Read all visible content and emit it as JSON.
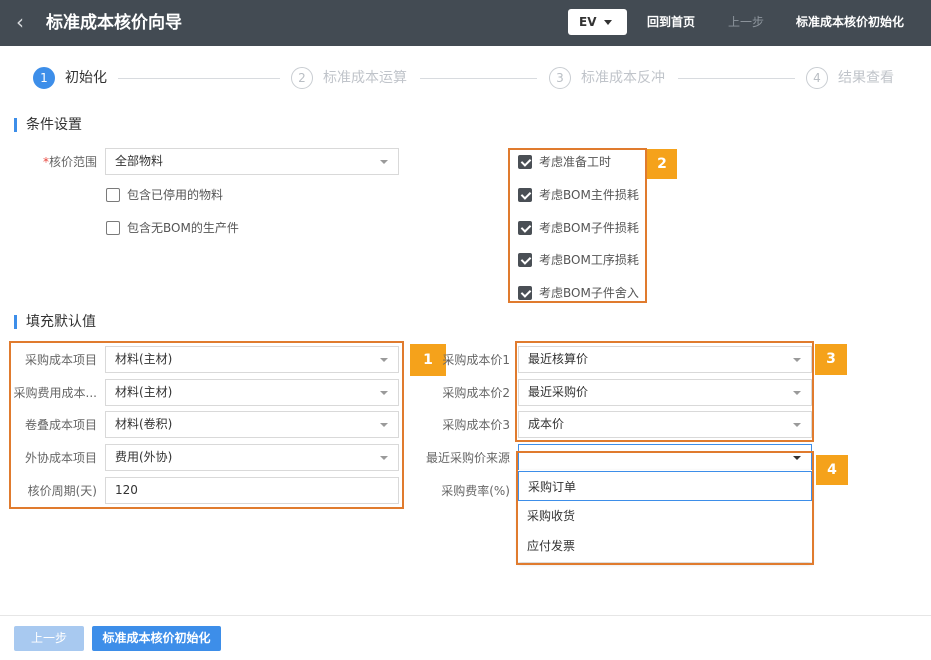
{
  "header": {
    "back_icon": "chevron-left-icon",
    "title": "标准成本核价向导",
    "ev_label": "EV",
    "home_link": "回到首页",
    "prev_link": "上一步",
    "init_link": "标准成本核价初始化"
  },
  "steps": [
    {
      "num": "1",
      "label": "初始化",
      "active": true
    },
    {
      "num": "2",
      "label": "标准成本运算",
      "active": false
    },
    {
      "num": "3",
      "label": "标准成本反冲",
      "active": false
    },
    {
      "num": "4",
      "label": "结果查看",
      "active": false
    }
  ],
  "conditions": {
    "title": "条件设置",
    "scope_required_mark": "*",
    "scope_label": "核价范围",
    "scope_value": "全部物料",
    "include_disabled": "包含已停用的物料",
    "include_no_bom": "包含无BOM的生产件",
    "options": [
      {
        "label": "考虑准备工时",
        "checked": true
      },
      {
        "label": "考虑BOM主件损耗",
        "checked": true
      },
      {
        "label": "考虑BOM子件损耗",
        "checked": true
      },
      {
        "label": "考虑BOM工序损耗",
        "checked": true
      },
      {
        "label": "考虑BOM子件舍入",
        "checked": true
      }
    ]
  },
  "defaults": {
    "title": "填充默认值",
    "left": [
      {
        "label": "采购成本项目",
        "value": "材料(主材)"
      },
      {
        "label": "采购费用成本...",
        "value": "材料(主材)"
      },
      {
        "label": "卷叠成本项目",
        "value": "材料(卷积)"
      },
      {
        "label": "外协成本项目",
        "value": "费用(外协)"
      },
      {
        "label": "核价周期(天)",
        "value": "120"
      }
    ],
    "right": [
      {
        "label": "采购成本价1",
        "value": "最近核算价"
      },
      {
        "label": "采购成本价2",
        "value": "最近采购价"
      },
      {
        "label": "采购成本价3",
        "value": "成本价"
      },
      {
        "label": "最近采购价来源",
        "value": ""
      },
      {
        "label": "采购费率(%)",
        "value": ""
      }
    ],
    "source_options": [
      "采购订单",
      "采购收货",
      "应付发票"
    ]
  },
  "tags": [
    "1",
    "2",
    "3",
    "4"
  ],
  "footer": {
    "prev_button": "上一步",
    "init_button": "标准成本核价初始化"
  },
  "colors": {
    "accent": "#3d8ee9",
    "header_bg": "#434b53",
    "highlight": "#e07b2e",
    "tag": "#f5a21b"
  }
}
